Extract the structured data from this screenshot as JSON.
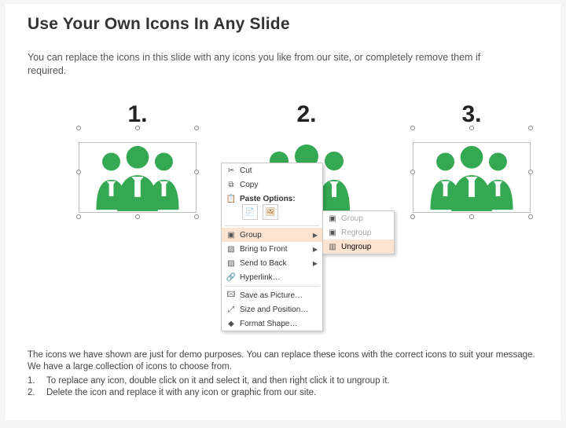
{
  "slide": {
    "title": "Use Your Own Icons In Any Slide",
    "subtitle": "You can replace the icons in this slide with any icons you like from our site, or completely remove them if required.",
    "numbers": [
      "1.",
      "2.",
      "3."
    ],
    "iconColor": "#34a853"
  },
  "context_menu": {
    "cut": "Cut",
    "copy": "Copy",
    "paste_header": "Paste Options:",
    "group": "Group",
    "bring_front": "Bring to Front",
    "send_back": "Send to Back",
    "hyperlink": "Hyperlink…",
    "save_picture": "Save as Picture…",
    "size_position": "Size and Position…",
    "format_shape": "Format Shape…"
  },
  "submenu": {
    "group": "Group",
    "regroup": "Regroup",
    "ungroup": "Ungroup"
  },
  "footer": {
    "intro": "The icons we have shown are just for demo purposes. You can replace these icons with the correct icons to suit your message. We have a large collection of icons to choose from.",
    "step1_n": "1.",
    "step1": "To replace any icon, double click on it and select it, and then right click it to ungroup it.",
    "step2_n": "2.",
    "step2": "Delete the icon and replace it with any icon or graphic from our site."
  }
}
